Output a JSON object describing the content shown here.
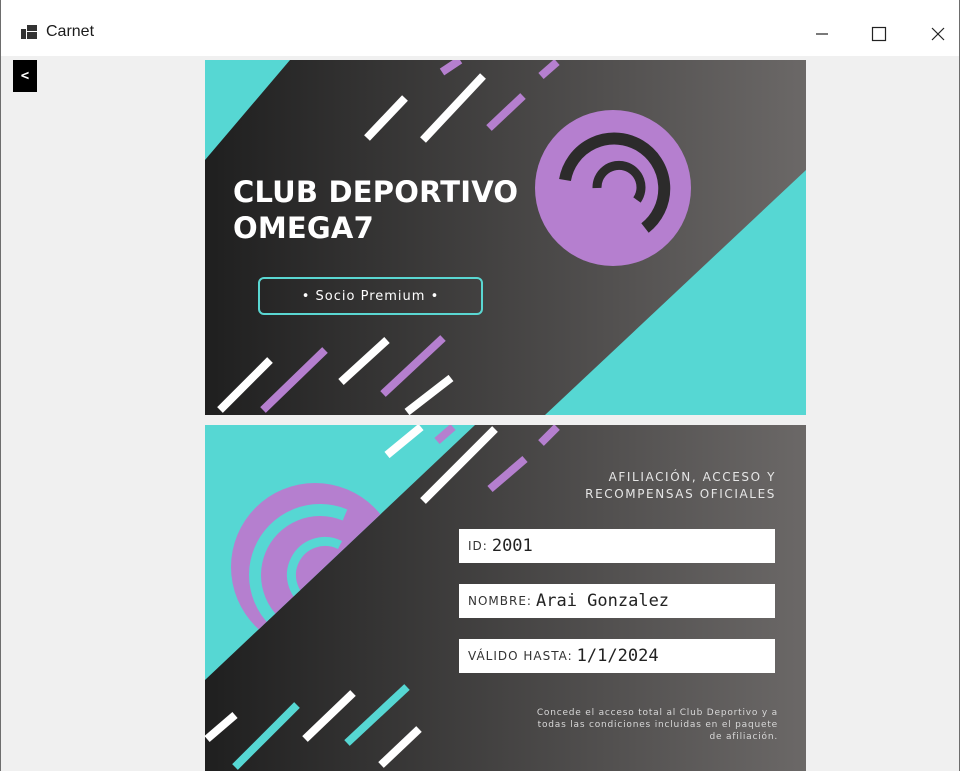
{
  "window": {
    "title": "Carnet",
    "icon": "app-icon"
  },
  "titlebar": {
    "minimize_icon": "minimize-icon",
    "maximize_icon": "maximize-icon",
    "close_icon": "close-icon"
  },
  "toolbar": {
    "back_label": "<"
  },
  "card_front": {
    "title_line1": "CLUB DEPORTIVO",
    "title_line2": "OMEGA7",
    "badge": "• Socio Premium •"
  },
  "card_back": {
    "heading_line1": "AFILIACIÓN, ACCESO Y",
    "heading_line2": "RECOMPENSAS OFICIALES",
    "id_label": "ID:",
    "id_value": "2001",
    "name_label": "NOMBRE:",
    "name_value": "Arai Gonzalez",
    "valid_label": "VÁLIDO HASTA:",
    "valid_value": "1/1/2024",
    "note_line1": "Concede el acceso total al Club Deportivo y a",
    "note_line2": "todas las condiciones incluidas en el paquete",
    "note_line3": "de afiliación."
  },
  "colors": {
    "teal": "#56d7d3",
    "purple": "#b57fcf",
    "dark": "#2c2b2b",
    "client_bg": "#f0f0f0"
  }
}
